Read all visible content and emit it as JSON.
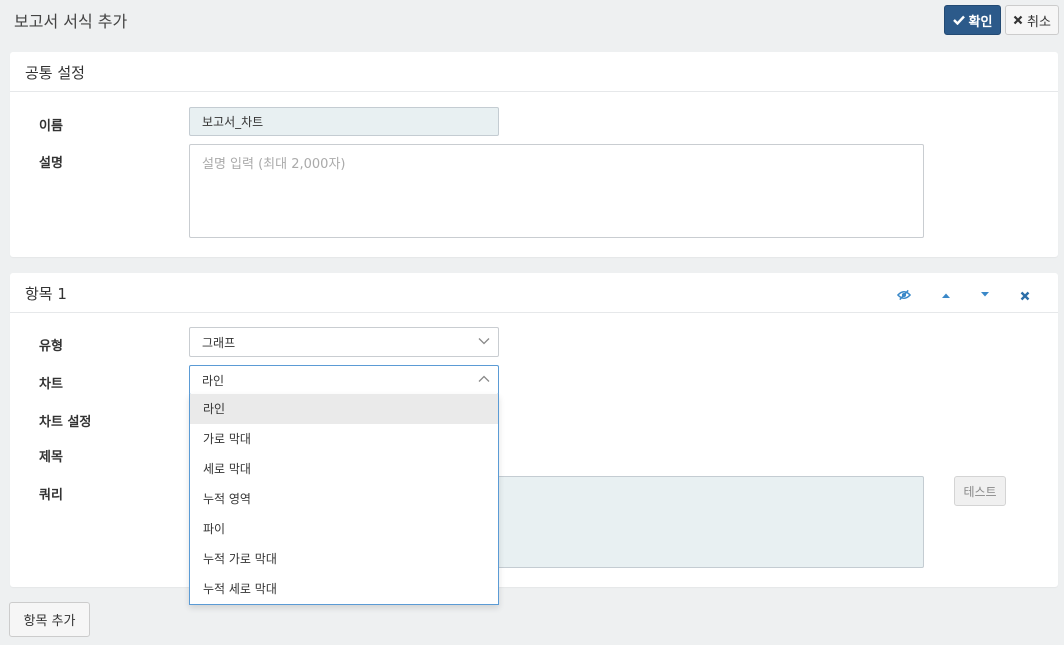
{
  "page": {
    "title": "보고서 서식 추가"
  },
  "toolbar": {
    "confirm_label": "확인",
    "cancel_label": "취소"
  },
  "common_panel": {
    "title": "공통 설정",
    "name_label": "이름",
    "name_value": "보고서_차트",
    "desc_label": "설명",
    "desc_placeholder": "설명 입력 (최대 2,000자)"
  },
  "item_panel": {
    "title": "항목 1",
    "type_label": "유형",
    "type_value": "그래프",
    "chart_label": "차트",
    "chart_value": "라인",
    "chart_settings_label": "차트 설정",
    "subject_label": "제목",
    "query_label": "쿼리",
    "test_label": "테스트"
  },
  "chart_dropdown": {
    "options": [
      "라인",
      "가로 막대",
      "세로 막대",
      "누적 영역",
      "파이",
      "누적 가로 막대",
      "누적 세로 막대"
    ],
    "selected_index": 0
  },
  "footer": {
    "add_item_label": "항목 추가"
  },
  "colors": {
    "primary": "#2c5a8a",
    "icon_blue": "#3a88c8",
    "focus_border": "#5b9bd5"
  }
}
